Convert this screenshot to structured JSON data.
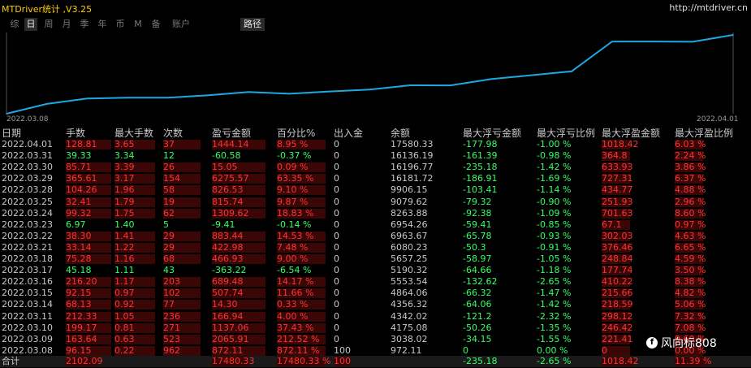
{
  "app_title": "MTDriver统计 ,V3.25",
  "site_link": "http://mtdriver.cn",
  "tabs": [
    {
      "label": "综",
      "active": false
    },
    {
      "label": "日",
      "active": true
    },
    {
      "label": "周",
      "active": false
    },
    {
      "label": "月",
      "active": false
    },
    {
      "label": "季",
      "active": false
    },
    {
      "label": "年",
      "active": false
    },
    {
      "label": "币",
      "active": false
    },
    {
      "label": "M",
      "active": false
    },
    {
      "label": "备",
      "active": false
    },
    {
      "label": "账户",
      "active": false
    },
    {
      "label": "路径",
      "active": true
    }
  ],
  "chart_data": {
    "type": "line",
    "x": [
      "2022.03.08",
      "2022.03.09",
      "2022.03.10",
      "2022.03.11",
      "2022.03.14",
      "2022.03.15",
      "2022.03.16",
      "2022.03.17",
      "2022.03.18",
      "2022.03.21",
      "2022.03.22",
      "2022.03.23",
      "2022.03.24",
      "2022.03.25",
      "2022.03.28",
      "2022.03.29",
      "2022.03.30",
      "2022.03.31",
      "2022.04.01"
    ],
    "values": [
      972.11,
      3038.02,
      4175.08,
      4342.02,
      4356.32,
      4864.06,
      5553.54,
      5190.32,
      5657.25,
      6080.23,
      6963.67,
      6954.26,
      8263.88,
      9079.62,
      9906.15,
      16181.72,
      16196.77,
      16136.19,
      17580.33
    ],
    "x_start_label": "2022.03.08",
    "x_end_label": "2022.04.01",
    "line_color": "#1ea8e0"
  },
  "table": {
    "headers": [
      "日期",
      "手数",
      "最大手数",
      "次数",
      "盈亏金额",
      "百分比%",
      "出入金",
      "余额",
      "最大浮亏金额",
      "最大浮亏比例",
      "最大浮盈金额",
      "最大浮盈比例"
    ],
    "rows": [
      {
        "date": "2022.04.01",
        "lots": "128.81",
        "max_lots": "3.65",
        "count": "37",
        "pnl": "1444.14",
        "pct": "8.95 %",
        "io": "0",
        "balance": "17580.33",
        "max_dd": "-177.98",
        "max_dd_pct": "-1.00 %",
        "max_fp": "1018.42",
        "max_fp_pct": "6.03 %",
        "sign": "pos"
      },
      {
        "date": "2022.03.31",
        "lots": "39.33",
        "max_lots": "3.34",
        "count": "12",
        "pnl": "-60.58",
        "pct": "-0.37 %",
        "io": "0",
        "balance": "16136.19",
        "max_dd": "-161.39",
        "max_dd_pct": "-0.98 %",
        "max_fp": "364.8",
        "max_fp_pct": "2.24 %",
        "sign": "neg"
      },
      {
        "date": "2022.03.30",
        "lots": "85.71",
        "max_lots": "3.39",
        "count": "26",
        "pnl": "15.05",
        "pct": "0.09 %",
        "io": "0",
        "balance": "16196.77",
        "max_dd": "-235.18",
        "max_dd_pct": "-1.42 %",
        "max_fp": "633.93",
        "max_fp_pct": "3.86 %",
        "sign": "pos"
      },
      {
        "date": "2022.03.29",
        "lots": "365.61",
        "max_lots": "3.17",
        "count": "154",
        "pnl": "6275.57",
        "pct": "63.35 %",
        "io": "0",
        "balance": "16181.72",
        "max_dd": "-186.91",
        "max_dd_pct": "-1.69 %",
        "max_fp": "727.31",
        "max_fp_pct": "6.37 %",
        "sign": "pos"
      },
      {
        "date": "2022.03.28",
        "lots": "104.26",
        "max_lots": "1.96",
        "count": "58",
        "pnl": "826.53",
        "pct": "9.10 %",
        "io": "0",
        "balance": "9906.15",
        "max_dd": "-103.41",
        "max_dd_pct": "-1.14 %",
        "max_fp": "434.77",
        "max_fp_pct": "4.88 %",
        "sign": "pos"
      },
      {
        "date": "2022.03.25",
        "lots": "32.41",
        "max_lots": "1.79",
        "count": "19",
        "pnl": "815.74",
        "pct": "9.87 %",
        "io": "0",
        "balance": "9079.62",
        "max_dd": "-79.32",
        "max_dd_pct": "-0.90 %",
        "max_fp": "251.93",
        "max_fp_pct": "2.96 %",
        "sign": "pos"
      },
      {
        "date": "2022.03.24",
        "lots": "99.32",
        "max_lots": "1.75",
        "count": "62",
        "pnl": "1309.62",
        "pct": "18.83 %",
        "io": "0",
        "balance": "8263.88",
        "max_dd": "-92.38",
        "max_dd_pct": "-1.09 %",
        "max_fp": "701.63",
        "max_fp_pct": "8.60 %",
        "sign": "pos"
      },
      {
        "date": "2022.03.23",
        "lots": "6.97",
        "max_lots": "1.40",
        "count": "5",
        "pnl": "-9.41",
        "pct": "-0.14 %",
        "io": "0",
        "balance": "6954.26",
        "max_dd": "-59.41",
        "max_dd_pct": "-0.85 %",
        "max_fp": "67.1",
        "max_fp_pct": "0.97 %",
        "sign": "neg"
      },
      {
        "date": "2022.03.22",
        "lots": "38.30",
        "max_lots": "1.41",
        "count": "29",
        "pnl": "883.44",
        "pct": "14.53 %",
        "io": "0",
        "balance": "6963.67",
        "max_dd": "-65.78",
        "max_dd_pct": "-0.93 %",
        "max_fp": "302.03",
        "max_fp_pct": "4.63 %",
        "sign": "pos"
      },
      {
        "date": "2022.03.21",
        "lots": "33.14",
        "max_lots": "1.22",
        "count": "29",
        "pnl": "422.98",
        "pct": "7.48 %",
        "io": "0",
        "balance": "6080.23",
        "max_dd": "-50.3",
        "max_dd_pct": "-0.91 %",
        "max_fp": "376.46",
        "max_fp_pct": "6.65 %",
        "sign": "pos"
      },
      {
        "date": "2022.03.18",
        "lots": "75.28",
        "max_lots": "1.16",
        "count": "68",
        "pnl": "466.93",
        "pct": "9.00 %",
        "io": "0",
        "balance": "5657.25",
        "max_dd": "-58.97",
        "max_dd_pct": "-1.05 %",
        "max_fp": "248.84",
        "max_fp_pct": "4.59 %",
        "sign": "pos"
      },
      {
        "date": "2022.03.17",
        "lots": "45.18",
        "max_lots": "1.11",
        "count": "43",
        "pnl": "-363.22",
        "pct": "-6.54 %",
        "io": "0",
        "balance": "5190.32",
        "max_dd": "-64.66",
        "max_dd_pct": "-1.18 %",
        "max_fp": "177.74",
        "max_fp_pct": "3.50 %",
        "sign": "neg"
      },
      {
        "date": "2022.03.16",
        "lots": "216.20",
        "max_lots": "1.17",
        "count": "203",
        "pnl": "689.48",
        "pct": "14.17 %",
        "io": "0",
        "balance": "5553.54",
        "max_dd": "-132.62",
        "max_dd_pct": "-2.65 %",
        "max_fp": "410.22",
        "max_fp_pct": "8.38 %",
        "sign": "pos"
      },
      {
        "date": "2022.03.15",
        "lots": "92.15",
        "max_lots": "0.97",
        "count": "102",
        "pnl": "507.74",
        "pct": "11.66 %",
        "io": "0",
        "balance": "4864.06",
        "max_dd": "-66.32",
        "max_dd_pct": "-1.47 %",
        "max_fp": "215.66",
        "max_fp_pct": "4.82 %",
        "sign": "pos"
      },
      {
        "date": "2022.03.14",
        "lots": "68.13",
        "max_lots": "0.92",
        "count": "77",
        "pnl": "14.30",
        "pct": "0.33 %",
        "io": "0",
        "balance": "4356.32",
        "max_dd": "-64.06",
        "max_dd_pct": "-1.42 %",
        "max_fp": "218.59",
        "max_fp_pct": "5.06 %",
        "sign": "pos"
      },
      {
        "date": "2022.03.11",
        "lots": "212.33",
        "max_lots": "1.05",
        "count": "236",
        "pnl": "166.94",
        "pct": "4.00 %",
        "io": "0",
        "balance": "4342.02",
        "max_dd": "-121.2",
        "max_dd_pct": "-2.32 %",
        "max_fp": "298.12",
        "max_fp_pct": "7.32 %",
        "sign": "pos"
      },
      {
        "date": "2022.03.10",
        "lots": "199.17",
        "max_lots": "0.81",
        "count": "271",
        "pnl": "1137.06",
        "pct": "37.43 %",
        "io": "0",
        "balance": "4175.08",
        "max_dd": "-50.26",
        "max_dd_pct": "-1.35 %",
        "max_fp": "246.42",
        "max_fp_pct": "7.08 %",
        "sign": "pos"
      },
      {
        "date": "2022.03.09",
        "lots": "163.64",
        "max_lots": "0.63",
        "count": "523",
        "pnl": "2065.91",
        "pct": "212.52 %",
        "io": "0",
        "balance": "3038.02",
        "max_dd": "-34.15",
        "max_dd_pct": "-1.55 %",
        "max_fp": "221.41",
        "max_fp_pct": "9.60 %",
        "sign": "pos"
      },
      {
        "date": "2022.03.08",
        "lots": "96.15",
        "max_lots": "0.22",
        "count": "962",
        "pnl": "872.11",
        "pct": "872.11 %",
        "io": "100",
        "balance": "972.11",
        "max_dd": "0",
        "max_dd_pct": "0.00 %",
        "max_fp": "0",
        "max_fp_pct": "0.00 %",
        "sign": "pos"
      }
    ],
    "total": {
      "label": "合计",
      "lots": "2102.09",
      "pnl": "17480.33",
      "pct": "17480.33 %",
      "io": "100",
      "max_dd": "-235.18",
      "max_dd_pct": "-2.65 %",
      "max_fp": "1018.42",
      "max_fp_pct": "11.39 %"
    }
  },
  "watermark": {
    "icon": "f",
    "text": "风向标808"
  },
  "colors": {
    "positive": "#ff3333",
    "negative": "#33ff66",
    "title": "#ffcc00",
    "line": "#1ea8e0"
  }
}
